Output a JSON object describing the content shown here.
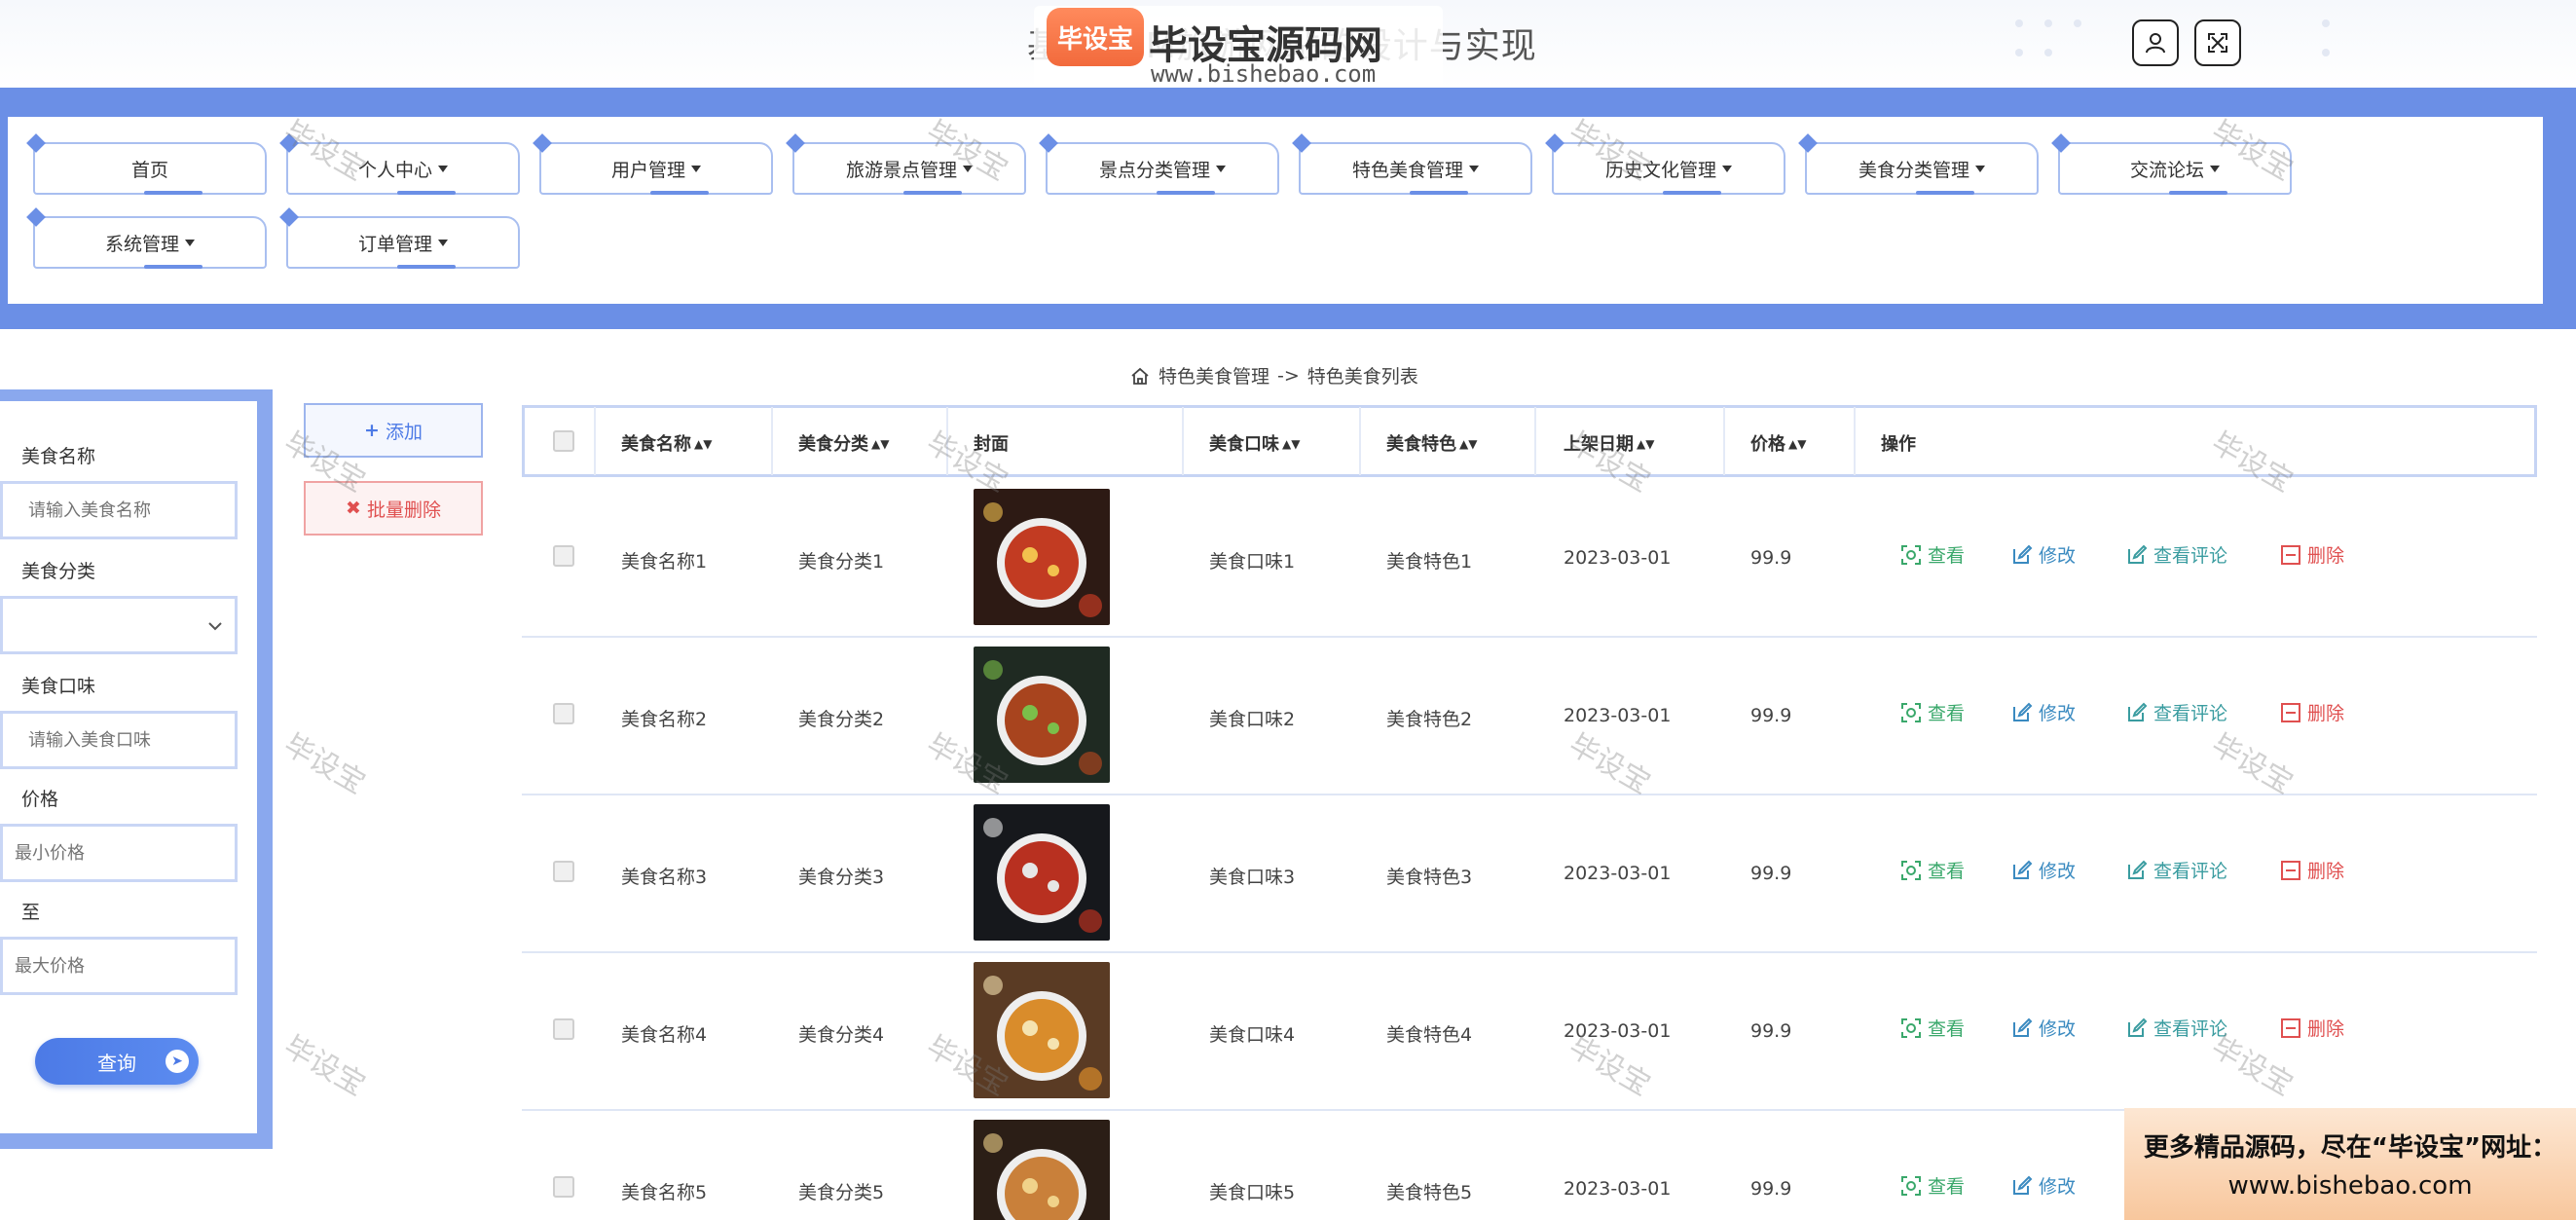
{
  "header": {
    "title": "基于SSM旅游网站的设计与实现",
    "logo_badge": "毕设宝",
    "logo_name": "毕设宝源码网",
    "logo_url": "www.bishebao.com"
  },
  "nav": {
    "items": [
      {
        "label": "首页",
        "dropdown": false
      },
      {
        "label": "个人中心",
        "dropdown": true
      },
      {
        "label": "用户管理",
        "dropdown": true
      },
      {
        "label": "旅游景点管理",
        "dropdown": true
      },
      {
        "label": "景点分类管理",
        "dropdown": true
      },
      {
        "label": "特色美食管理",
        "dropdown": true
      },
      {
        "label": "历史文化管理",
        "dropdown": true
      },
      {
        "label": "美食分类管理",
        "dropdown": true
      },
      {
        "label": "交流论坛",
        "dropdown": true
      },
      {
        "label": "系统管理",
        "dropdown": true
      },
      {
        "label": "订单管理",
        "dropdown": true
      }
    ]
  },
  "breadcrumb": {
    "section": "特色美食管理",
    "separator": "->",
    "page": "特色美食列表"
  },
  "search": {
    "name_label": "美食名称",
    "name_placeholder": "请输入美食名称",
    "category_label": "美食分类",
    "taste_label": "美食口味",
    "taste_placeholder": "请输入美食口味",
    "price_label": "价格",
    "min_placeholder": "最小价格",
    "to_label": "至",
    "max_placeholder": "最大价格",
    "query_label": "查询"
  },
  "actions": {
    "add_label": "添加",
    "batch_delete_label": "批量删除"
  },
  "table": {
    "headers": {
      "name": "美食名称",
      "category": "美食分类",
      "cover": "封面",
      "taste": "美食口味",
      "feature": "美食特色",
      "date": "上架日期",
      "price": "价格",
      "ops": "操作"
    },
    "op_labels": {
      "view": "查看",
      "edit": "修改",
      "review": "查看评论",
      "delete": "删除"
    },
    "rows": [
      {
        "name": "美食名称1",
        "category": "美食分类1",
        "taste": "美食口味1",
        "feature": "美食特色1",
        "date": "2023-03-01",
        "price": "99.9"
      },
      {
        "name": "美食名称2",
        "category": "美食分类2",
        "taste": "美食口味2",
        "feature": "美食特色2",
        "date": "2023-03-01",
        "price": "99.9"
      },
      {
        "name": "美食名称3",
        "category": "美食分类3",
        "taste": "美食口味3",
        "feature": "美食特色3",
        "date": "2023-03-01",
        "price": "99.9"
      },
      {
        "name": "美食名称4",
        "category": "美食分类4",
        "taste": "美食口味4",
        "feature": "美食特色4",
        "date": "2023-03-01",
        "price": "99.9"
      },
      {
        "name": "美食名称5",
        "category": "美食分类5",
        "taste": "美食口味5",
        "feature": "美食特色5",
        "date": "2023-03-01",
        "price": "99.9"
      }
    ]
  },
  "watermark": "毕设宝",
  "promo": {
    "line1": "更多精品源码，尽在“毕设宝”网址：",
    "line2": "www.bishebao.com"
  },
  "colors": {
    "primary": "#6b8fe6",
    "view": "#3aa86b",
    "edit": "#3a8ac0",
    "review": "#3a9ca0",
    "delete": "#e05050"
  }
}
